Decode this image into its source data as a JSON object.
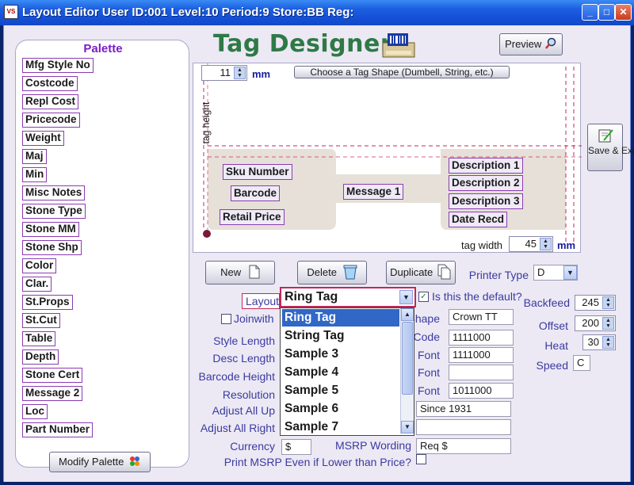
{
  "window": {
    "app_icon": "VS",
    "title": "Layout Editor    User ID:001  Level:10  Period:9  Store:BB  Reg:",
    "minimize": "_",
    "maximize": "□",
    "close": "✕"
  },
  "palette": {
    "title": "Palette",
    "items": [
      "Mfg Style No",
      "Costcode",
      "Repl Cost",
      "Pricecode",
      "Weight",
      "Maj",
      "Min",
      "Misc Notes",
      "Stone Type",
      "Stone MM",
      "Stone Shp",
      "Color",
      "Clar.",
      "St.Props",
      "St.Cut",
      "Table",
      "Depth",
      "Stone Cert",
      "Message 2",
      "Loc",
      "Part Number"
    ],
    "modify_label": "Modify Palette"
  },
  "header": {
    "title": "Tag Designer",
    "preview_label": "Preview",
    "save_exit_label": "Save & Exit"
  },
  "canvas": {
    "tag_height_value": "11",
    "tag_height_label": "tag height",
    "tag_width_value": "45",
    "tag_width_label": "tag width",
    "unit": "mm",
    "choose_shape_label": "Choose a Tag Shape (Dumbell, String, etc.)",
    "fields": [
      "Sku Number",
      "Barcode",
      "Retail Price",
      "Message 1",
      "Description 1",
      "Description 2",
      "Description 3",
      "Date Recd"
    ]
  },
  "actions": {
    "new_label": "New",
    "delete_label": "Delete",
    "duplicate_label": "Duplicate",
    "printer_type_label": "Printer Type",
    "printer_type_value": "D"
  },
  "form": {
    "layout_label": "Layout",
    "layout_value": "Ring Tag",
    "is_default_label": "Is this the default?",
    "joinwith_label": "Joinwith",
    "style_length_label": "Style Length",
    "desc_length_label": "Desc Length",
    "barcode_height_label": "Barcode Height",
    "resolution_label": "Resolution",
    "adjust_all_up_label": "Adjust All Up",
    "adjust_all_right_label": "Adjust All Right",
    "currency_label": "Currency",
    "currency_value": "$",
    "shape_label": "Shape",
    "shape_value": "Crown TT",
    "code_label": "Code",
    "code_value": "1111000",
    "font1_label": "Font",
    "font1_value": "1111000",
    "font2_label": "Font",
    "font2_value": "",
    "font3_label": "Font",
    "font3_value": "1011000",
    "since_value": "Since 1931",
    "msrp_wording_label": "MSRP Wording",
    "msrp_wording_value": "Req $",
    "print_msrp_label": "Print MSRP Even if Lower than Price?",
    "backfeed_label": "Backfeed",
    "backfeed_value": "245",
    "offset_label": "Offset",
    "offset_value": "200",
    "heat_label": "Heat",
    "heat_value": "30",
    "speed_label": "Speed",
    "speed_value": "C"
  },
  "layout_dropdown": {
    "options": [
      "Ring Tag",
      "String Tag",
      "Sample 3",
      "Sample 4",
      "Sample 5",
      "Sample 6",
      "Sample 7"
    ],
    "selected_index": 0
  },
  "colors": {
    "accent_purple": "#8a3cb0",
    "title_green": "#2e7a46",
    "label_blue": "#3a3aa0",
    "selection_blue": "#3167c6",
    "titlebar_blue": "#1c5fe0"
  }
}
